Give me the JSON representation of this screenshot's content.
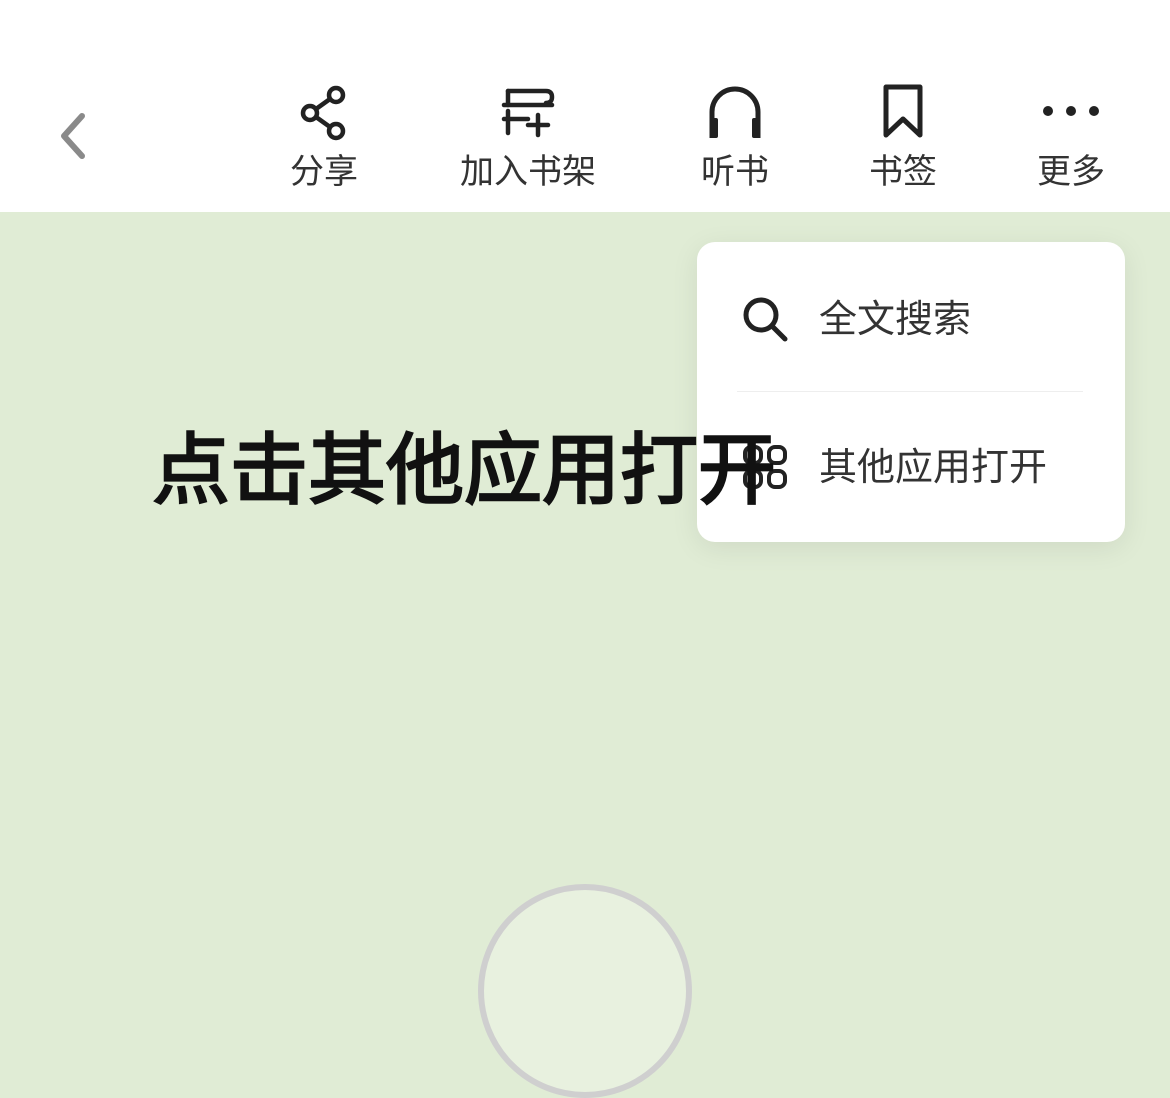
{
  "toolbar": {
    "back_icon": "chevron-left-icon",
    "items": [
      {
        "label": "分享",
        "icon": "share-icon"
      },
      {
        "label": "加入书架",
        "icon": "add-to-shelf-icon"
      },
      {
        "label": "听书",
        "icon": "headphones-icon"
      },
      {
        "label": "书签",
        "icon": "bookmark-icon"
      },
      {
        "label": "更多",
        "icon": "more-icon"
      }
    ]
  },
  "overlay_caption": "点击其他应用打开",
  "menu": {
    "items": [
      {
        "label": "全文搜索",
        "icon": "search-icon"
      },
      {
        "label": "其他应用打开",
        "icon": "apps-grid-icon"
      }
    ]
  },
  "colors": {
    "reader_background": "#e0ecd5",
    "toolbar_background": "#ffffff",
    "icon_color": "#222222",
    "back_icon_color": "#8a8a8a"
  }
}
